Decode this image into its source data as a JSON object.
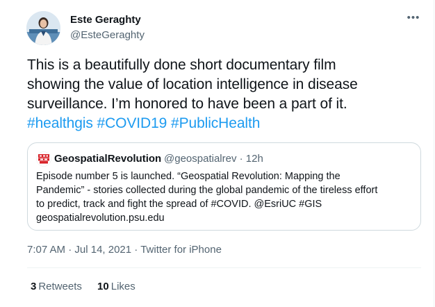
{
  "author": {
    "name": "Este Geraghty",
    "handle": "@EsteGeraghty",
    "avatar_icon": "user-avatar-photo"
  },
  "more_icon": "more-options-icon",
  "tweet": {
    "lines": [
      {
        "text": "This is a beautifully done short documentary film"
      },
      {
        "text": "showing the value of location intelligence in disease"
      },
      {
        "text": "surveillance. I’m honored to have been a part of it."
      }
    ],
    "hashtags": [
      "#healthgis",
      "#COVID19",
      "#PublicHealth"
    ]
  },
  "quoted": {
    "name": "GeospatialRevolution",
    "meta": "@geospatialrev · 12h",
    "avatar_icon": "geospatial-revolution-logo",
    "lines": [
      "Episode number 5 is launched. “Geospatial Revolution: Mapping the",
      "Pandemic” - stories collected during the global pandemic of the tireless effort",
      "to predict, track and fight the spread of #COVID. @EsriUC #GIS",
      "geospatialrevolution.psu.edu"
    ]
  },
  "meta": {
    "time": "7:07 AM",
    "sep1": " · ",
    "date": "Jul 14, 2021",
    "sep2": " · ",
    "source": "Twitter for iPhone"
  },
  "stats": {
    "retweets_count": "3",
    "retweets_label": "Retweets",
    "likes_count": "10",
    "likes_label": "Likes"
  },
  "colors": {
    "link": "#1d9bf0",
    "text": "#0f1419",
    "secondary": "#536471",
    "border": "#cfd9de"
  }
}
